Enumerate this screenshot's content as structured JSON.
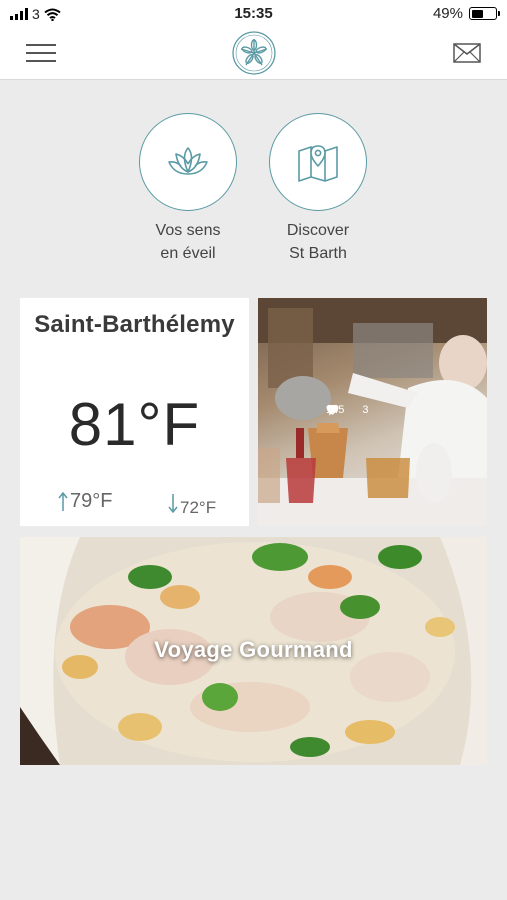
{
  "status_bar": {
    "carrier": "3",
    "time": "15:35",
    "battery": "49%",
    "battery_level": 0.49
  },
  "header": {
    "menu_icon": "hamburger-icon",
    "logo_icon": "sand-dollar-logo-icon",
    "mail_icon": "envelope-icon"
  },
  "categories": [
    {
      "label": "Vos sens\nen éveil",
      "icon": "lotus-icon"
    },
    {
      "label": "Discover\nSt Barth",
      "icon": "map-pin-icon"
    }
  ],
  "weather": {
    "location": "Saint-Barthélemy",
    "temperature": "81°F",
    "high": "79°F",
    "low": "72°F"
  },
  "photo_card": {
    "likes": "145",
    "comments": "3"
  },
  "food_card": {
    "title": "Voyage Gourmand"
  },
  "colors": {
    "accent": "#5a9aa4",
    "background": "#ebebeb"
  }
}
